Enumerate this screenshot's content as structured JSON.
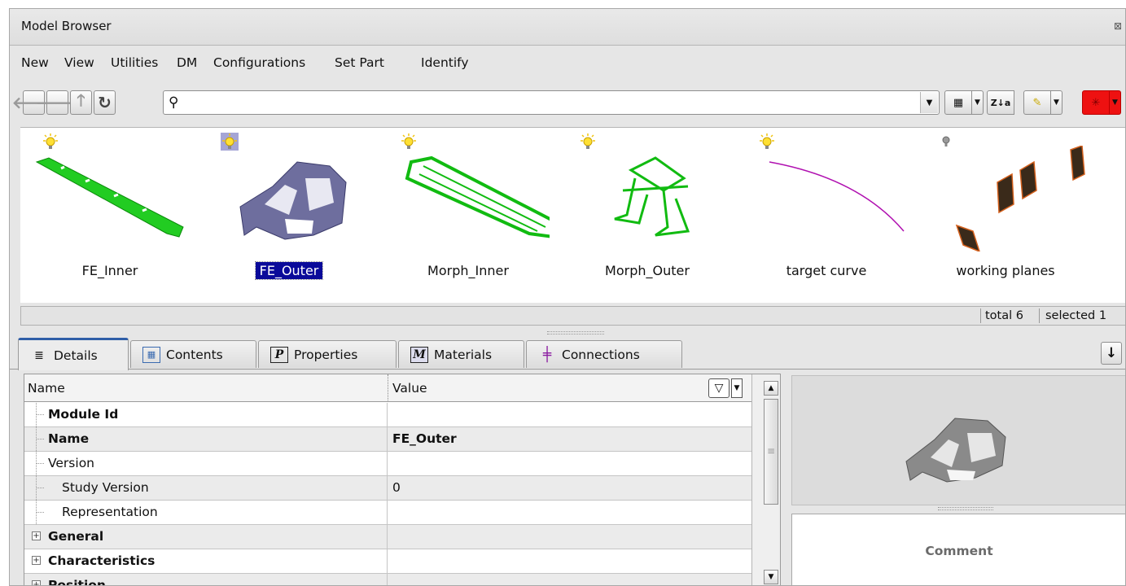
{
  "window": {
    "title": "Model Browser",
    "close_glyph": "⊠"
  },
  "menu": [
    "New",
    "View",
    "Utilities",
    "DM",
    "Configurations",
    "Set Part",
    "Identify"
  ],
  "toolbar": {
    "search_placeholder": "",
    "buttons": [
      "back-icon",
      "forward-icon",
      "up-icon",
      "refresh-icon"
    ],
    "sort_label": "Z↓a",
    "highlight_color": "#ee1111"
  },
  "parts": [
    {
      "name": "FE_Inner",
      "lit": true,
      "selected": false,
      "color": "#22cc22"
    },
    {
      "name": "FE_Outer",
      "lit": true,
      "selected": true,
      "color": "#5a5a8a"
    },
    {
      "name": "Morph_Inner",
      "lit": true,
      "selected": false,
      "color": "#11bb11"
    },
    {
      "name": "Morph_Outer",
      "lit": true,
      "selected": false,
      "color": "#11bb11"
    },
    {
      "name": "target curve",
      "lit": true,
      "selected": false,
      "color": "#b010b0"
    },
    {
      "name": "working planes",
      "lit": false,
      "selected": false,
      "color": "#8a3a1a"
    }
  ],
  "status": {
    "total": "total 6",
    "selected": "selected 1"
  },
  "tabs": [
    "Details",
    "Contents",
    "Properties",
    "Materials",
    "Connections"
  ],
  "grid": {
    "col_name": "Name",
    "col_value": "Value",
    "rows": [
      {
        "name": "Module Id",
        "value": ""
      },
      {
        "name": "Name",
        "value": "FE_Outer"
      },
      {
        "name": "Version",
        "value": ""
      },
      {
        "name": "Study Version",
        "value": "0"
      },
      {
        "name": "Representation",
        "value": ""
      },
      {
        "name": "General",
        "value": ""
      },
      {
        "name": "Characteristics",
        "value": ""
      },
      {
        "name": "Position",
        "value": ""
      }
    ]
  },
  "comment": {
    "label": "Comment"
  }
}
